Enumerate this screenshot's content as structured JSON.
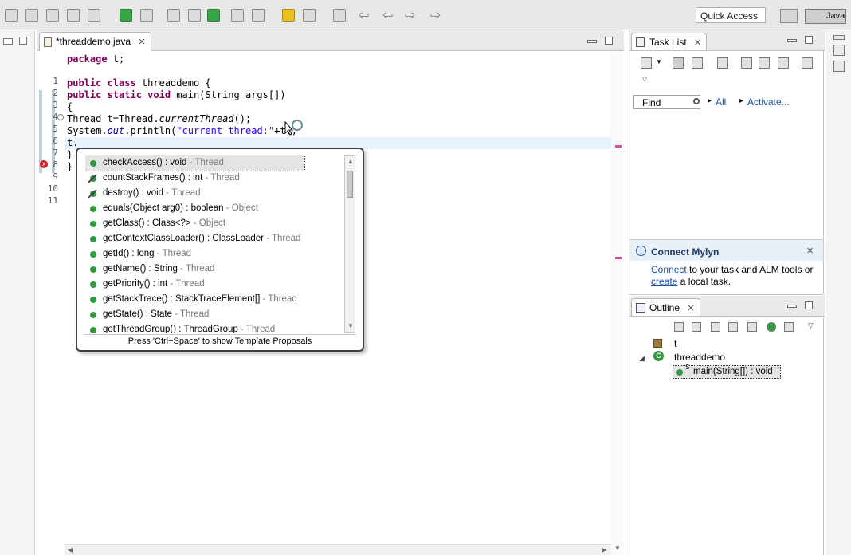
{
  "toolbar": {
    "quick_access": "Quick Access",
    "perspective": "Java"
  },
  "editor": {
    "tab_title": "*threaddemo.java",
    "tab_close": "✕",
    "lines": [
      {
        "num": "1",
        "code": "package t;"
      },
      {
        "num": "2",
        "code": ""
      },
      {
        "num": "3",
        "code": "public class threaddemo {"
      },
      {
        "num": "4",
        "code": "public static void main(String args[])"
      },
      {
        "num": "5",
        "code": "{"
      },
      {
        "num": "6",
        "code": "Thread t=Thread.currentThread();"
      },
      {
        "num": "7",
        "code": "System.out.println(\"current thread:\"+t);"
      },
      {
        "num": "8",
        "code": "t."
      },
      {
        "num": "9",
        "code": "}"
      },
      {
        "num": "10",
        "code": "}"
      },
      {
        "num": "11",
        "code": ""
      }
    ],
    "line1_kw": "package",
    "line1_rest": " t;",
    "line3_kw": "public class",
    "line3_rest": " threaddemo {",
    "line4_kw": "public static void",
    "line4_rest": " main(String args[])",
    "line5": "{",
    "line6_a": "Thread t=Thread.",
    "line6_it": "currentThread",
    "line6_b": "();",
    "line7_a": "System.",
    "line7_fd": "out",
    "line7_b": ".println(",
    "line7_str": "\"current thread:\"",
    "line7_c": "+t);",
    "line8": "t.",
    "line9": "}",
    "line10": "}",
    "error_icon": "x"
  },
  "content_assist": {
    "proposals": [
      {
        "sig": "checkAccess() : void",
        "owner": " - Thread",
        "deprecated": false
      },
      {
        "sig": "countStackFrames() : int",
        "owner": " - Thread",
        "deprecated": true
      },
      {
        "sig": "destroy() : void",
        "owner": " - Thread",
        "deprecated": true
      },
      {
        "sig": "equals(Object arg0) : boolean",
        "owner": " - Object",
        "deprecated": false
      },
      {
        "sig": "getClass() : Class<?>",
        "owner": " - Object",
        "deprecated": false
      },
      {
        "sig": "getContextClassLoader() : ClassLoader",
        "owner": " - Thread",
        "deprecated": false
      },
      {
        "sig": "getId() : long",
        "owner": " - Thread",
        "deprecated": false
      },
      {
        "sig": "getName() : String",
        "owner": " - Thread",
        "deprecated": false
      },
      {
        "sig": "getPriority() : int",
        "owner": " - Thread",
        "deprecated": false
      },
      {
        "sig": "getStackTrace() : StackTraceElement[]",
        "owner": " - Thread",
        "deprecated": false
      },
      {
        "sig": "getState() : State",
        "owner": " - Thread",
        "deprecated": false
      },
      {
        "sig": "getThreadGroup() : ThreadGroup",
        "owner": " - Thread",
        "deprecated": false
      }
    ],
    "footer": "Press 'Ctrl+Space' to show Template Proposals"
  },
  "tasklist": {
    "title": "Task List",
    "close": "✕",
    "find_placeholder": "Find",
    "all_label": "All",
    "activate_label": "Activate...",
    "arrow": "▸"
  },
  "mylyn": {
    "title": "Connect Mylyn",
    "info_glyph": "i",
    "close": "✕",
    "connect_link": "Connect",
    "text1": " to your task and ALM tools or",
    "create_link": "create",
    "text2": " a local task."
  },
  "outline": {
    "title": "Outline",
    "close": "✕",
    "package": "t",
    "class_name": "threaddemo",
    "class_glyph": "C",
    "method": "main(String[]) : void",
    "method_mod": "S",
    "expand": "◢"
  }
}
